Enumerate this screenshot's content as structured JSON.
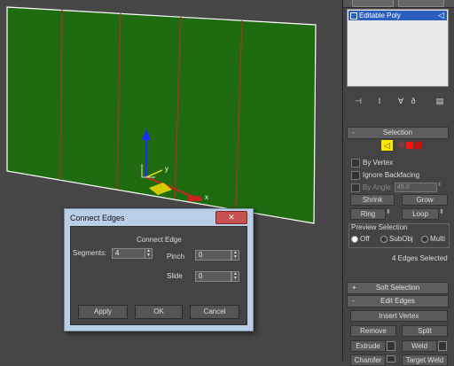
{
  "modifier_stack": {
    "item": "Editable Poly"
  },
  "selection": {
    "title": "Selection",
    "by_vertex": "By Vertex",
    "ignore_backfacing": "Ignore Backfacing",
    "by_angle": "By Angle:",
    "by_angle_value": "45.0",
    "shrink": "Shrink",
    "grow": "Grow",
    "ring": "Ring",
    "loop": "Loop",
    "preview_selection": "Preview Selection",
    "preview_off": "Off",
    "preview_subobj": "SubObj",
    "preview_multi": "Multi",
    "status": "4 Edges Selected"
  },
  "soft_selection": {
    "title": "Soft Selection"
  },
  "edit_edges": {
    "title": "Edit Edges",
    "insert_vertex": "Insert Vertex",
    "remove": "Remove",
    "split": "Split",
    "extrude": "Extrude",
    "weld": "Weld",
    "chamfer": "Chamfer",
    "target_weld": "Target Weld"
  },
  "viewport": {
    "gizmo_x": "x",
    "gizmo_y": "y"
  },
  "dialog": {
    "title": "Connect Edges",
    "close": "✕",
    "group": "Connect Edge",
    "segments_label": "Segments:",
    "segments_value": "4",
    "pinch_label": "Pinch",
    "pinch_value": "0",
    "slide_label": "Slide",
    "slide_value": "0",
    "apply": "Apply",
    "ok": "OK",
    "cancel": "Cancel"
  },
  "colors": {
    "plane": "#1f6b10",
    "edge_selected": "#b03020",
    "accent": "#ffe600"
  }
}
